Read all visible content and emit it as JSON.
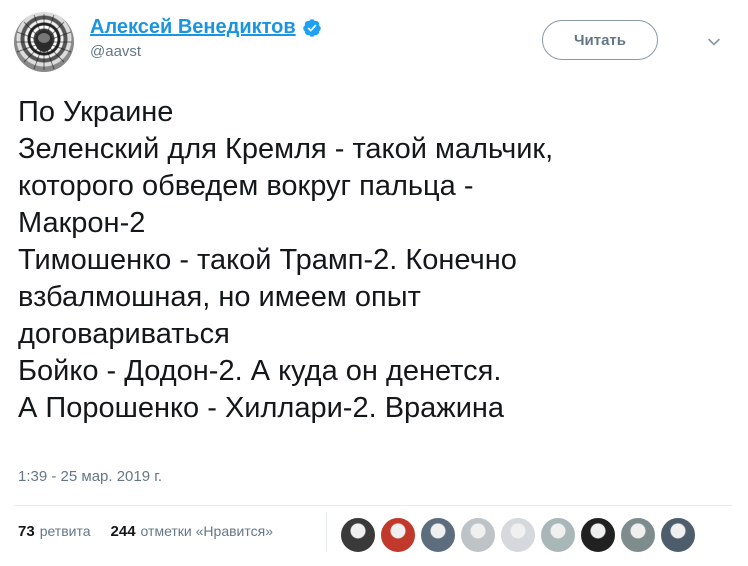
{
  "author": {
    "display_name": "Алексей Венедиктов",
    "handle": "@aavst",
    "verified": true
  },
  "follow_button_label": "Читать",
  "tweet": {
    "lines": [
      "По Украине",
      "Зеленский для Кремля - такой мальчик,",
      "которого обведем вокруг пальца -",
      "Макрон-2",
      "Тимошенко - такой Трамп-2. Конечно",
      "взбалмошная, но имеем опыт",
      "договариваться",
      "Бойко - Додон-2. А куда он денется.",
      "А Порошенко - Хиллари-2. Вражина"
    ],
    "timestamp": "1:39 - 25 мар. 2019 г."
  },
  "stats": {
    "retweets_count": "73",
    "retweets_label": "ретвита",
    "likes_count": "244",
    "likes_label": "отметки «Нравится»"
  },
  "likers": [
    {
      "name": "liker-1",
      "color": "#3a3a3a"
    },
    {
      "name": "liker-2",
      "color": "#c0392b"
    },
    {
      "name": "liker-3",
      "color": "#5d6d7e"
    },
    {
      "name": "liker-4",
      "color": "#bdc3c7"
    },
    {
      "name": "liker-5",
      "color": "#d5d8dc"
    },
    {
      "name": "liker-6",
      "color": "#aab7b8"
    },
    {
      "name": "liker-7",
      "color": "#212121"
    },
    {
      "name": "liker-8",
      "color": "#7f8c8d"
    },
    {
      "name": "liker-9",
      "color": "#4e5d6c"
    }
  ],
  "colors": {
    "link": "#1b95e0",
    "muted": "#657786",
    "text": "#14171a",
    "verified": "#1da1f2"
  }
}
